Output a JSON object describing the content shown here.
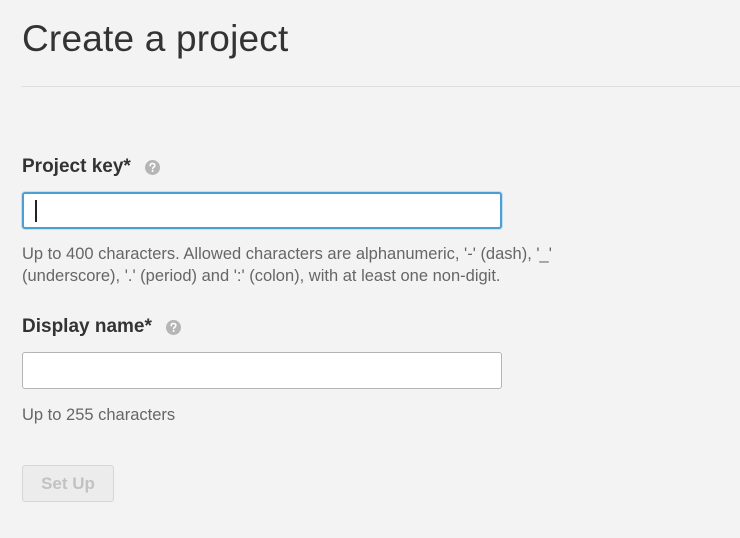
{
  "page": {
    "title": "Create a project"
  },
  "form": {
    "project_key": {
      "label": "Project key*",
      "help_icon": "question-icon",
      "value": "",
      "placeholder": "",
      "hint_line1": "Up to 400 characters. Allowed characters are alphanumeric, '-' (dash), '_'",
      "hint_line2": "(underscore), '.' (period) and ':' (colon), with at least one non-digit."
    },
    "display_name": {
      "label": "Display name*",
      "help_icon": "question-icon",
      "value": "",
      "placeholder": "",
      "hint": "Up to 255 characters"
    },
    "submit": {
      "label": "Set Up",
      "disabled": true
    }
  },
  "colors": {
    "background": "#f3f3f3",
    "focus_border": "#4b9fd5",
    "hint_text": "#666666",
    "disabled_text": "#c2c2c2"
  }
}
